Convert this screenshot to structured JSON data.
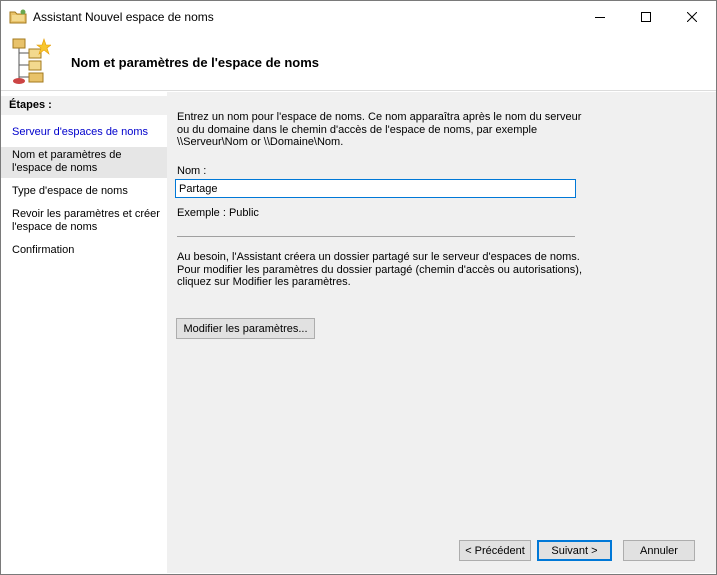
{
  "window": {
    "title": "Assistant Nouvel espace de noms"
  },
  "header": {
    "title": "Nom et paramètres de l'espace de noms"
  },
  "steps": {
    "title": "Étapes :",
    "items": [
      {
        "label": "Serveur d'espaces de noms"
      },
      {
        "label": "Nom et paramètres de l'espace de noms"
      },
      {
        "label": "Type d'espace de noms"
      },
      {
        "label": "Revoir les paramètres et créer l'espace de noms"
      },
      {
        "label": "Confirmation"
      }
    ]
  },
  "main": {
    "intro_line1": "Entrez un nom pour l'espace de noms. Ce nom apparaîtra après le nom du serveur",
    "intro_line2": "ou du domaine dans le chemin d'accès de l'espace de noms, par exemple",
    "intro_line3": "\\\\Serveur\\Nom or \\\\Domaine\\Nom.",
    "name_label": "Nom :",
    "name_value": "Partage",
    "example": "Exemple : Public",
    "info_line1": "Au besoin, l'Assistant créera un dossier partagé sur le serveur d'espaces de noms.",
    "info_line2": "Pour modifier les paramètres du dossier partagé (chemin d'accès ou autorisations),",
    "info_line3": "cliquez sur Modifier les paramètres.",
    "modify_button": "Modifier les paramètres..."
  },
  "footer": {
    "previous": "< Précédent",
    "next": "Suivant >",
    "cancel": "Annuler"
  }
}
